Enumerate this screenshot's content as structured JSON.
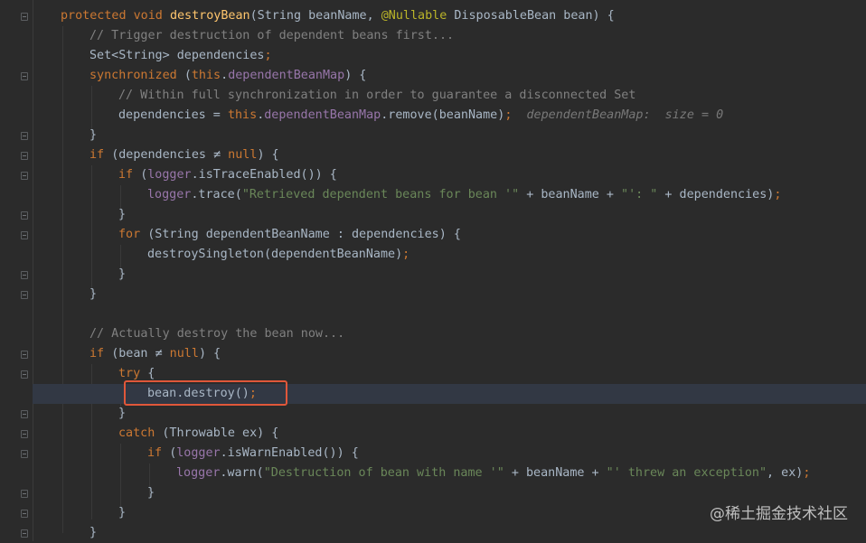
{
  "watermark": "@稀土掘金技术社区",
  "lines": [
    {
      "segs": [
        [
          "kw",
          "protected void "
        ],
        [
          "fn",
          "destroyBean"
        ],
        [
          "",
          "(String beanName, "
        ],
        [
          "ann",
          "@Nullable "
        ],
        [
          "",
          "DisposableBean bean) {"
        ]
      ]
    },
    {
      "segs": [
        [
          "cmt",
          "// Trigger destruction of dependent beans first..."
        ]
      ]
    },
    {
      "segs": [
        [
          "",
          "Set<String> dependencies"
        ],
        [
          "kw",
          ";"
        ]
      ]
    },
    {
      "segs": [
        [
          "kw",
          "synchronized "
        ],
        [
          "",
          "("
        ],
        [
          "kw",
          "this"
        ],
        [
          "",
          "."
        ],
        [
          "fld",
          "dependentBeanMap"
        ],
        [
          "",
          ") {"
        ]
      ]
    },
    {
      "segs": [
        [
          "cmt",
          "// Within full synchronization in order to guarantee a disconnected Set"
        ]
      ]
    },
    {
      "segs": [
        [
          "",
          "dependencies = "
        ],
        [
          "kw",
          "this"
        ],
        [
          "",
          "."
        ],
        [
          "fld",
          "dependentBeanMap"
        ],
        [
          "",
          ".remove(beanName)"
        ],
        [
          "kw",
          ";"
        ],
        [
          "hint",
          "  dependentBeanMap:  size = 0"
        ]
      ]
    },
    {
      "segs": [
        [
          "",
          "}"
        ]
      ]
    },
    {
      "segs": [
        [
          "kw",
          "if "
        ],
        [
          "",
          "(dependencies "
        ],
        [
          "ne",
          "≠"
        ],
        [
          "kw",
          " null"
        ],
        [
          "",
          ") {"
        ]
      ]
    },
    {
      "segs": [
        [
          "kw",
          "if "
        ],
        [
          "",
          "("
        ],
        [
          "fld",
          "logger"
        ],
        [
          "",
          ".isTraceEnabled()) {"
        ]
      ]
    },
    {
      "segs": [
        [
          "fld",
          "logger"
        ],
        [
          "",
          ".trace("
        ],
        [
          "str",
          "\"Retrieved dependent beans for bean '\""
        ],
        [
          "",
          " + beanName + "
        ],
        [
          "str",
          "\"': \""
        ],
        [
          "",
          " + dependencies)"
        ],
        [
          "kw",
          ";"
        ]
      ]
    },
    {
      "segs": [
        [
          "",
          "}"
        ]
      ]
    },
    {
      "segs": [
        [
          "kw",
          "for "
        ],
        [
          "",
          "(String dependentBeanName : dependencies) {"
        ]
      ]
    },
    {
      "segs": [
        [
          "",
          "destroySingleton(dependentBeanName)"
        ],
        [
          "kw",
          ";"
        ]
      ]
    },
    {
      "segs": [
        [
          "",
          "}"
        ]
      ]
    },
    {
      "segs": [
        [
          "",
          "}"
        ]
      ]
    },
    {
      "segs": []
    },
    {
      "segs": [
        [
          "cmt",
          "// Actually destroy the bean now..."
        ]
      ]
    },
    {
      "segs": [
        [
          "kw",
          "if "
        ],
        [
          "",
          "(bean "
        ],
        [
          "ne",
          "≠"
        ],
        [
          "kw",
          " null"
        ],
        [
          "",
          ") {"
        ]
      ]
    },
    {
      "segs": [
        [
          "kw",
          "try "
        ],
        [
          "",
          "{"
        ]
      ]
    },
    {
      "segs": [
        [
          "",
          "bean.destroy()"
        ],
        [
          "kw",
          ";"
        ]
      ]
    },
    {
      "segs": [
        [
          "",
          "}"
        ]
      ]
    },
    {
      "segs": [
        [
          "kw",
          "catch "
        ],
        [
          "",
          "(Throwable ex) {"
        ]
      ]
    },
    {
      "segs": [
        [
          "kw",
          "if "
        ],
        [
          "",
          "("
        ],
        [
          "fld",
          "logger"
        ],
        [
          "",
          ".isWarnEnabled()) {"
        ]
      ]
    },
    {
      "segs": [
        [
          "fld",
          "logger"
        ],
        [
          "",
          ".warn("
        ],
        [
          "str",
          "\"Destruction of bean with name '\""
        ],
        [
          "",
          " + beanName + "
        ],
        [
          "str",
          "\"' threw an exception\""
        ],
        [
          "",
          ", ex)"
        ],
        [
          "kw",
          ";"
        ]
      ]
    },
    {
      "segs": [
        [
          "",
          "}"
        ]
      ]
    },
    {
      "segs": [
        [
          "",
          "}"
        ]
      ]
    },
    {
      "segs": [
        [
          "",
          "}"
        ]
      ]
    }
  ]
}
